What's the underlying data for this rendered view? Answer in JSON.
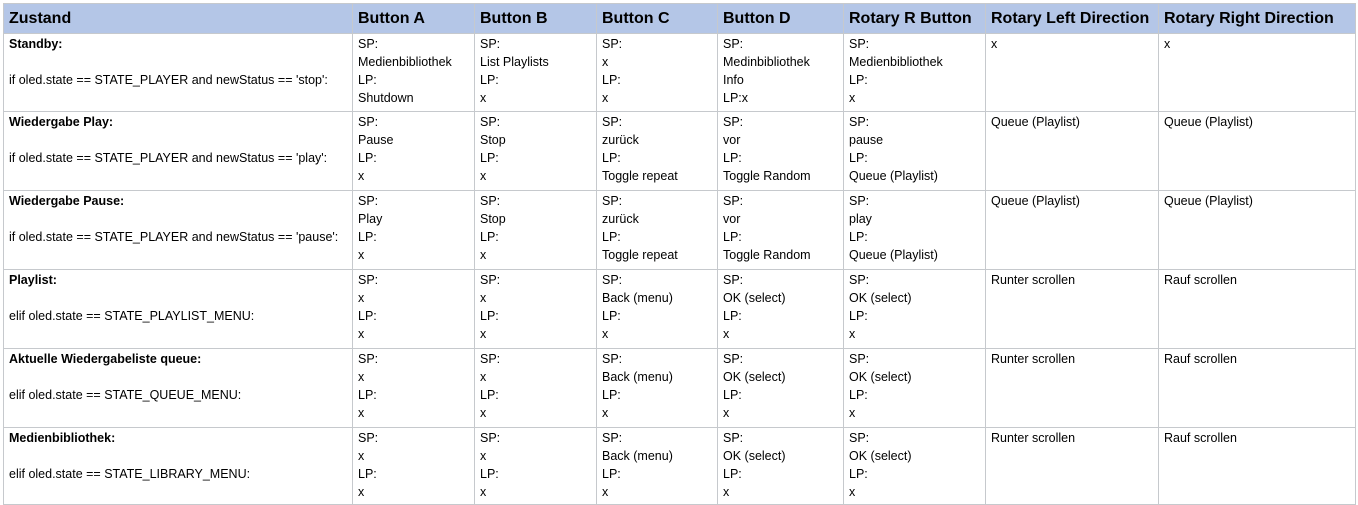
{
  "headers": [
    "Zustand",
    "Button A",
    "Button B",
    "Button C",
    "Button D",
    "Rotary R Button",
    "Rotary Left Direction",
    "Rotary Right Direction"
  ],
  "rows": [
    {
      "state_title": "Standby:",
      "state_code": "if oled.state == STATE_PLAYER and newStatus == 'stop':",
      "cells": [
        [
          "SP:",
          "Medienbibliothek",
          "LP:",
          "Shutdown"
        ],
        [
          "SP:",
          "List Playlists",
          "LP:",
          "x"
        ],
        [
          "SP:",
          "x",
          "LP:",
          "x"
        ],
        [
          "SP:",
          "Medinbibliothek",
          "Info",
          "LP:x"
        ],
        [
          "SP:",
          "Medienbibliothek",
          "LP:",
          "x"
        ],
        [
          "x"
        ],
        [
          "x"
        ]
      ]
    },
    {
      "state_title": "Wiedergabe Play:",
      "state_code": "if oled.state == STATE_PLAYER and newStatus == 'play':",
      "cells": [
        [
          "SP:",
          "Pause",
          "LP:",
          "x"
        ],
        [
          "SP:",
          "Stop",
          "LP:",
          "x"
        ],
        [
          "SP:",
          "zurück",
          "LP:",
          "Toggle repeat"
        ],
        [
          "SP:",
          "vor",
          "LP:",
          "Toggle Random"
        ],
        [
          "SP:",
          "pause",
          "LP:",
          "Queue (Playlist)"
        ],
        [
          "Queue (Playlist)"
        ],
        [
          "Queue (Playlist)"
        ]
      ]
    },
    {
      "state_title": "Wiedergabe Pause:",
      "state_code": "if oled.state == STATE_PLAYER and newStatus == 'pause':",
      "cells": [
        [
          "SP:",
          "Play",
          "LP:",
          "x"
        ],
        [
          "SP:",
          "Stop",
          "LP:",
          "x"
        ],
        [
          "SP:",
          "zurück",
          "LP:",
          "Toggle repeat"
        ],
        [
          "SP:",
          "vor",
          "LP:",
          "Toggle Random"
        ],
        [
          "SP:",
          "play",
          "LP:",
          "Queue (Playlist)"
        ],
        [
          "Queue (Playlist)"
        ],
        [
          "Queue (Playlist)"
        ]
      ]
    },
    {
      "state_title": "Playlist:",
      "state_code": "elif oled.state == STATE_PLAYLIST_MENU:",
      "cells": [
        [
          "SP:",
          "x",
          "LP:",
          "x"
        ],
        [
          "SP:",
          "x",
          "LP:",
          "x"
        ],
        [
          "SP:",
          "Back (menu)",
          "LP:",
          "x"
        ],
        [
          "SP:",
          "OK (select)",
          "LP:",
          "x"
        ],
        [
          "SP:",
          "OK (select)",
          "LP:",
          "x"
        ],
        [
          "Runter scrollen"
        ],
        [
          "Rauf scrollen"
        ]
      ]
    },
    {
      "state_title": "Aktuelle Wiedergabeliste queue:",
      "state_code": "elif oled.state == STATE_QUEUE_MENU:",
      "cells": [
        [
          "SP:",
          "x",
          "LP:",
          "x"
        ],
        [
          "SP:",
          "x",
          "LP:",
          "x"
        ],
        [
          "SP:",
          "Back (menu)",
          "LP:",
          "x"
        ],
        [
          "SP:",
          "OK (select)",
          "LP:",
          "x"
        ],
        [
          "SP:",
          "OK (select)",
          "LP:",
          "x"
        ],
        [
          "Runter scrollen"
        ],
        [
          "Rauf scrollen"
        ]
      ]
    },
    {
      "state_title": "Medienbibliothek:",
      "state_code": "elif oled.state == STATE_LIBRARY_MENU:",
      "cells": [
        [
          "SP:",
          "x",
          "LP:",
          "x"
        ],
        [
          "SP:",
          "x",
          "LP:",
          "x"
        ],
        [
          "SP:",
          "Back (menu)",
          "LP:",
          "x"
        ],
        [
          "SP:",
          "OK (select)",
          "LP:",
          "x"
        ],
        [
          "SP:",
          "OK (select)",
          "LP:",
          "x"
        ],
        [
          "Runter scrollen"
        ],
        [
          "Rauf scrollen"
        ]
      ]
    }
  ]
}
